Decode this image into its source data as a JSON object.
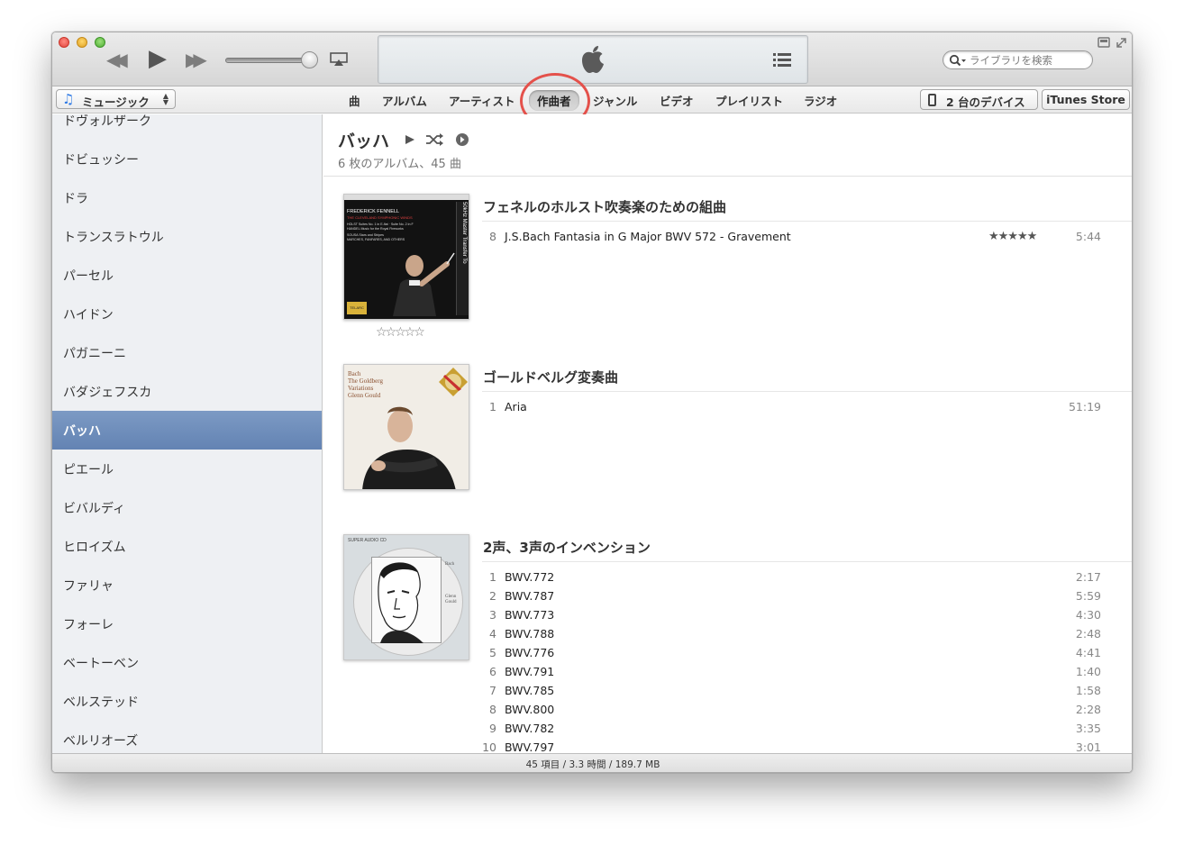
{
  "toolbar": {
    "search_placeholder": "ライブラリを検索"
  },
  "navbar": {
    "source_label": "ミュージック",
    "tabs": [
      {
        "label": "曲"
      },
      {
        "label": "アルバム"
      },
      {
        "label": "アーティスト"
      },
      {
        "label": "作曲者",
        "selected": true
      },
      {
        "label": "ジャンル"
      },
      {
        "label": "ビデオ"
      },
      {
        "label": "プレイリスト"
      },
      {
        "label": "ラジオ"
      }
    ],
    "devices_label": "2 台のデバイス",
    "store_label": "iTunes Store"
  },
  "sidebar": {
    "items": [
      {
        "label": "ドヴォルザーク"
      },
      {
        "label": "ドビュッシー"
      },
      {
        "label": "ドラ"
      },
      {
        "label": "トランスラトウル"
      },
      {
        "label": "パーセル"
      },
      {
        "label": "ハイドン"
      },
      {
        "label": "パガニーニ"
      },
      {
        "label": "バダジェフスカ"
      },
      {
        "label": "バッハ",
        "selected": true
      },
      {
        "label": "ピエール"
      },
      {
        "label": "ビバルディ"
      },
      {
        "label": "ヒロイズム"
      },
      {
        "label": "ファリャ"
      },
      {
        "label": "フォーレ"
      },
      {
        "label": "ベートーベン"
      },
      {
        "label": "ベルステッド"
      },
      {
        "label": "ベルリオーズ"
      }
    ]
  },
  "main": {
    "artist_name": "バッハ",
    "artist_summary": "6 枚のアルバム、45 曲",
    "albums": [
      {
        "title": "フェネルのホルスト吹奏楽のための組曲",
        "rating_text": "☆☆☆☆☆",
        "cover_text": {
          "line1": "FREDERICK FENNELL",
          "line2": "THE CLEVELAND SYMPHONIC WINDS",
          "line3": "HOLST  Suites No. 1 in E-flat · Suite No. 2 in F",
          "line4": "HANDEL  Music for the Royal Fireworks",
          "line5": "SOUSA  Stars and Stripes",
          "line6": "MARCHES, FANFARES, AND OTHERS",
          "side": "50kHz Master Transfer To",
          "label": "TELARC"
        },
        "tracks": [
          {
            "num": "8",
            "name": "J.S.Bach Fantasia in G Major BWV 572 - Gravement",
            "rating": "★★★★★",
            "time": "5:44"
          }
        ]
      },
      {
        "title": "ゴールドベルグ変奏曲",
        "cover_text": {
          "line1": "Bach",
          "line2": "The Goldberg",
          "line3": "Variations",
          "line4": "Glenn Gould"
        },
        "tracks": [
          {
            "num": "1",
            "name": "Aria",
            "time": "51:19"
          }
        ]
      },
      {
        "title": "2声、3声のインベンション",
        "cover_text": {
          "top": "SUPER AUDIO CD",
          "line1": "Bach",
          "line2": "Glenn",
          "line3": "Gould"
        },
        "tracks": [
          {
            "num": "1",
            "name": "BWV.772",
            "time": "2:17"
          },
          {
            "num": "2",
            "name": "BWV.787",
            "time": "5:59"
          },
          {
            "num": "3",
            "name": "BWV.773",
            "time": "4:30"
          },
          {
            "num": "4",
            "name": "BWV.788",
            "time": "2:48"
          },
          {
            "num": "5",
            "name": "BWV.776",
            "time": "4:41"
          },
          {
            "num": "6",
            "name": "BWV.791",
            "time": "1:40"
          },
          {
            "num": "7",
            "name": "BWV.785",
            "time": "1:58"
          },
          {
            "num": "8",
            "name": "BWV.800",
            "time": "2:28"
          },
          {
            "num": "9",
            "name": "BWV.782",
            "time": "3:35"
          },
          {
            "num": "10",
            "name": "BWV.797",
            "time": "3:01"
          }
        ]
      }
    ]
  },
  "status": {
    "summary": "45 項目 / 3.3 時間 / 189.7 MB"
  },
  "colors": {
    "selection": "#6f8dbb",
    "highlight_ring": "#e4514b",
    "accent_note": "#2f7ae5"
  }
}
